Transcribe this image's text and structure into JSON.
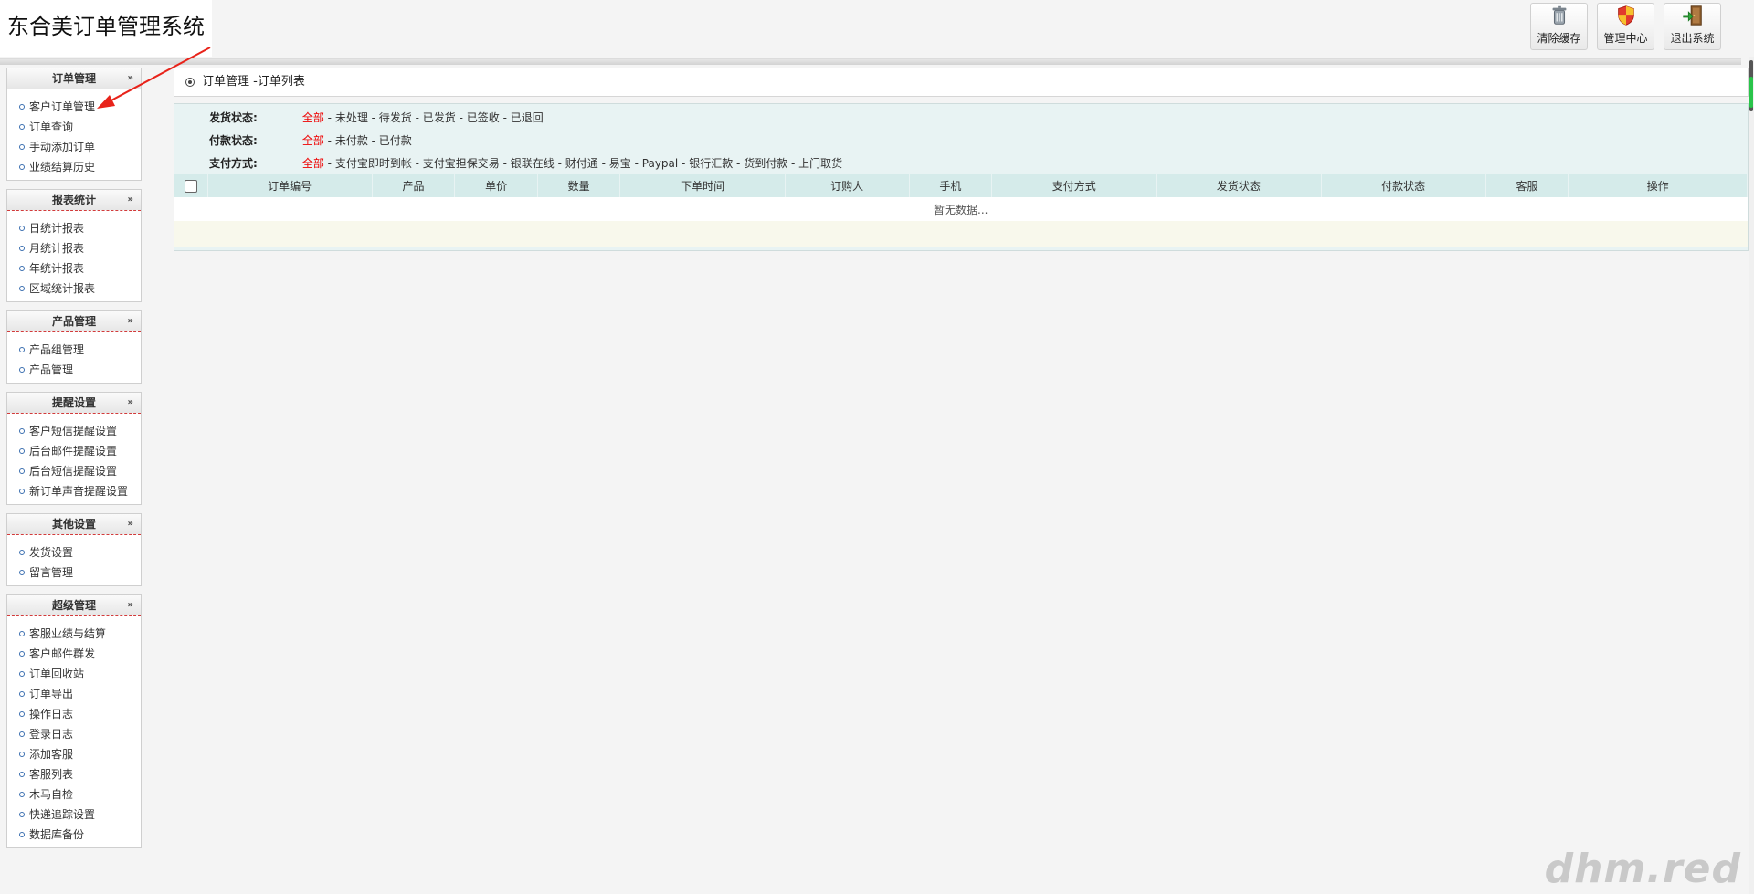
{
  "app": {
    "title": "东合美订单管理系统"
  },
  "toolbar": {
    "buttons": [
      {
        "label": "清除缓存",
        "icon": "trash-can-icon"
      },
      {
        "label": "管理中心",
        "icon": "shield-icon"
      },
      {
        "label": "退出系统",
        "icon": "exit-door-icon"
      }
    ]
  },
  "sidebar": {
    "groups": [
      {
        "title": "订单管理",
        "items": [
          "客户订单管理",
          "订单查询",
          "手动添加订单",
          "业绩结算历史"
        ]
      },
      {
        "title": "报表统计",
        "items": [
          "日统计报表",
          "月统计报表",
          "年统计报表",
          "区域统计报表"
        ]
      },
      {
        "title": "产品管理",
        "items": [
          "产品组管理",
          "产品管理"
        ]
      },
      {
        "title": "提醒设置",
        "items": [
          "客户短信提醒设置",
          "后台邮件提醒设置",
          "后台短信提醒设置",
          "新订单声音提醒设置"
        ]
      },
      {
        "title": "其他设置",
        "items": [
          "发货设置",
          "留言管理"
        ]
      },
      {
        "title": "超级管理",
        "items": [
          "客服业绩与结算",
          "客户邮件群发",
          "订单回收站",
          "订单导出",
          "操作日志",
          "登录日志",
          "添加客服",
          "客服列表",
          "木马自检",
          "快递追踪设置",
          "数据库备份"
        ]
      }
    ]
  },
  "main": {
    "title": "订单管理 -订单列表",
    "filters": [
      {
        "label": "发货状态:",
        "options": [
          "全部",
          "未处理",
          "待发货",
          "已发货",
          "已签收",
          "已退回"
        ]
      },
      {
        "label": "付款状态:",
        "options": [
          "全部",
          "未付款",
          "已付款"
        ]
      },
      {
        "label": "支付方式:",
        "options": [
          "全部",
          "支付宝即时到帐",
          "支付宝担保交易",
          "银联在线",
          "财付通",
          "易宝",
          "Paypal",
          "银行汇款",
          "货到付款",
          "上门取货"
        ]
      }
    ],
    "table": {
      "columns": [
        "订单编号",
        "产品",
        "单价",
        "数量",
        "下单时间",
        "订购人",
        "手机",
        "支付方式",
        "发货状态",
        "付款状态",
        "客服",
        "操作"
      ],
      "empty_text": "暂无数据..."
    }
  },
  "watermark": "dhm.red",
  "colors": {
    "active_filter": "#e00000",
    "table_header": "#d5ebea",
    "panel_bg": "#e8f3f3",
    "annotation_arrow": "#e8231a"
  }
}
